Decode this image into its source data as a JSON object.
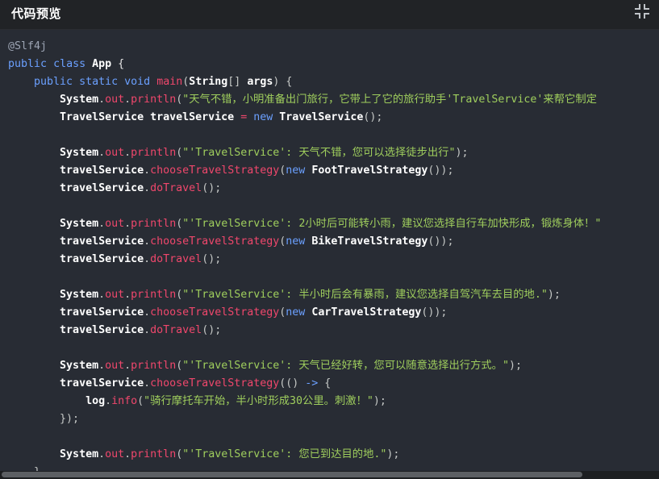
{
  "header": {
    "title": "代码预览",
    "collapse_icon": "collapse-icon"
  },
  "code": {
    "lines": [
      [
        [
          "ann",
          "@Slf4j"
        ]
      ],
      [
        [
          "kw",
          "public"
        ],
        [
          "plain",
          " "
        ],
        [
          "kw",
          "class"
        ],
        [
          "plain",
          " "
        ],
        [
          "class",
          "App"
        ],
        [
          "plain",
          " {"
        ]
      ],
      [
        [
          "plain",
          "    "
        ],
        [
          "kw",
          "public"
        ],
        [
          "plain",
          " "
        ],
        [
          "kw",
          "static"
        ],
        [
          "plain",
          " "
        ],
        [
          "kw",
          "void"
        ],
        [
          "plain",
          " "
        ],
        [
          "fn",
          "main"
        ],
        [
          "punct",
          "("
        ],
        [
          "class",
          "String"
        ],
        [
          "punct",
          "[] "
        ],
        [
          "class",
          "args"
        ],
        [
          "punct",
          ") {"
        ]
      ],
      [
        [
          "plain",
          "        "
        ],
        [
          "class",
          "System"
        ],
        [
          "punct",
          "."
        ],
        [
          "fn",
          "out"
        ],
        [
          "punct",
          "."
        ],
        [
          "fn",
          "println"
        ],
        [
          "punct",
          "("
        ],
        [
          "str",
          "\"天气不错，小明准备出门旅行，它带上了它的旅行助手'TravelService'来帮它制定"
        ]
      ],
      [
        [
          "plain",
          "        "
        ],
        [
          "class",
          "TravelService travelService"
        ],
        [
          "plain",
          " "
        ],
        [
          "op",
          "="
        ],
        [
          "plain",
          " "
        ],
        [
          "kw",
          "new"
        ],
        [
          "plain",
          " "
        ],
        [
          "class",
          "TravelService"
        ],
        [
          "punct",
          "();"
        ]
      ],
      [],
      [
        [
          "plain",
          "        "
        ],
        [
          "class",
          "System"
        ],
        [
          "punct",
          "."
        ],
        [
          "fn",
          "out"
        ],
        [
          "punct",
          "."
        ],
        [
          "fn",
          "println"
        ],
        [
          "punct",
          "("
        ],
        [
          "str",
          "\"'TravelService': 天气不错，您可以选择徒步出行\""
        ],
        [
          "punct",
          ");"
        ]
      ],
      [
        [
          "plain",
          "        "
        ],
        [
          "class",
          "travelService"
        ],
        [
          "punct",
          "."
        ],
        [
          "fn",
          "chooseTravelStrategy"
        ],
        [
          "punct",
          "("
        ],
        [
          "kw",
          "new"
        ],
        [
          "plain",
          " "
        ],
        [
          "class",
          "FootTravelStrategy"
        ],
        [
          "punct",
          "());"
        ]
      ],
      [
        [
          "plain",
          "        "
        ],
        [
          "class",
          "travelService"
        ],
        [
          "punct",
          "."
        ],
        [
          "fn",
          "doTravel"
        ],
        [
          "punct",
          "();"
        ]
      ],
      [],
      [
        [
          "plain",
          "        "
        ],
        [
          "class",
          "System"
        ],
        [
          "punct",
          "."
        ],
        [
          "fn",
          "out"
        ],
        [
          "punct",
          "."
        ],
        [
          "fn",
          "println"
        ],
        [
          "punct",
          "("
        ],
        [
          "str",
          "\"'TravelService': 2小时后可能转小雨，建议您选择自行车加快形成，锻炼身体！\""
        ]
      ],
      [
        [
          "plain",
          "        "
        ],
        [
          "class",
          "travelService"
        ],
        [
          "punct",
          "."
        ],
        [
          "fn",
          "chooseTravelStrategy"
        ],
        [
          "punct",
          "("
        ],
        [
          "kw",
          "new"
        ],
        [
          "plain",
          " "
        ],
        [
          "class",
          "BikeTravelStrategy"
        ],
        [
          "punct",
          "());"
        ]
      ],
      [
        [
          "plain",
          "        "
        ],
        [
          "class",
          "travelService"
        ],
        [
          "punct",
          "."
        ],
        [
          "fn",
          "doTravel"
        ],
        [
          "punct",
          "();"
        ]
      ],
      [],
      [
        [
          "plain",
          "        "
        ],
        [
          "class",
          "System"
        ],
        [
          "punct",
          "."
        ],
        [
          "fn",
          "out"
        ],
        [
          "punct",
          "."
        ],
        [
          "fn",
          "println"
        ],
        [
          "punct",
          "("
        ],
        [
          "str",
          "\"'TravelService': 半小时后会有暴雨，建议您选择自驾汽车去目的地.\""
        ],
        [
          "punct",
          ");"
        ]
      ],
      [
        [
          "plain",
          "        "
        ],
        [
          "class",
          "travelService"
        ],
        [
          "punct",
          "."
        ],
        [
          "fn",
          "chooseTravelStrategy"
        ],
        [
          "punct",
          "("
        ],
        [
          "kw",
          "new"
        ],
        [
          "plain",
          " "
        ],
        [
          "class",
          "CarTravelStrategy"
        ],
        [
          "punct",
          "());"
        ]
      ],
      [
        [
          "plain",
          "        "
        ],
        [
          "class",
          "travelService"
        ],
        [
          "punct",
          "."
        ],
        [
          "fn",
          "doTravel"
        ],
        [
          "punct",
          "();"
        ]
      ],
      [],
      [
        [
          "plain",
          "        "
        ],
        [
          "class",
          "System"
        ],
        [
          "punct",
          "."
        ],
        [
          "fn",
          "out"
        ],
        [
          "punct",
          "."
        ],
        [
          "fn",
          "println"
        ],
        [
          "punct",
          "("
        ],
        [
          "str",
          "\"'TravelService': 天气已经好转，您可以随意选择出行方式。\""
        ],
        [
          "punct",
          ");"
        ]
      ],
      [
        [
          "plain",
          "        "
        ],
        [
          "class",
          "travelService"
        ],
        [
          "punct",
          "."
        ],
        [
          "fn",
          "chooseTravelStrategy"
        ],
        [
          "punct",
          "(() "
        ],
        [
          "arrow",
          "->"
        ],
        [
          "punct",
          " {"
        ]
      ],
      [
        [
          "plain",
          "            "
        ],
        [
          "class",
          "log"
        ],
        [
          "punct",
          "."
        ],
        [
          "fn",
          "info"
        ],
        [
          "punct",
          "("
        ],
        [
          "str",
          "\"骑行摩托车开始，半小时形成30公里。刺激！\""
        ],
        [
          "punct",
          ");"
        ]
      ],
      [
        [
          "plain",
          "        "
        ],
        [
          "punct",
          "});"
        ]
      ],
      [],
      [
        [
          "plain",
          "        "
        ],
        [
          "class",
          "System"
        ],
        [
          "punct",
          "."
        ],
        [
          "fn",
          "out"
        ],
        [
          "punct",
          "."
        ],
        [
          "fn",
          "println"
        ],
        [
          "punct",
          "("
        ],
        [
          "str",
          "\"'TravelService': 您已到达目的地.\""
        ],
        [
          "punct",
          ");"
        ]
      ],
      [
        [
          "plain",
          "    "
        ],
        [
          "punct",
          "}"
        ]
      ]
    ]
  },
  "colors": {
    "background": "#282c34",
    "header_bg": "#212326",
    "keyword": "#6ba0ff",
    "function": "#f0476c",
    "string": "#9fce5d"
  }
}
